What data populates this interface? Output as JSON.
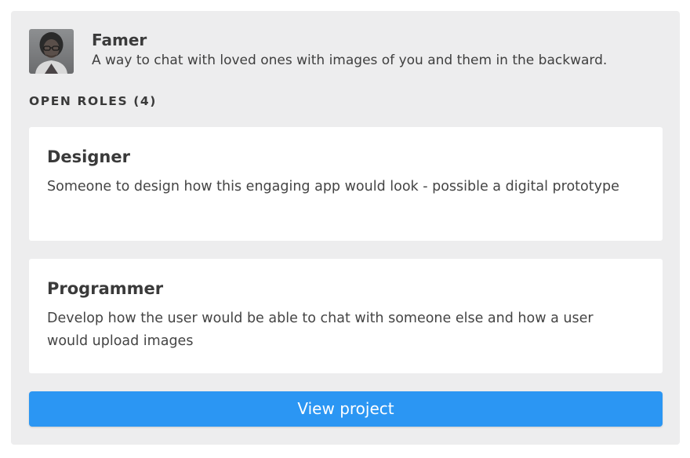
{
  "project": {
    "name": "Famer",
    "description": "A way to chat with loved ones with images of you and them in the backward.",
    "avatar_icon": "person-portrait-icon"
  },
  "roles": {
    "heading": "OPEN ROLES (4)",
    "items": [
      {
        "title": "Designer",
        "description": "Someone to design how this engaging app would look - possible a digital prototype"
      },
      {
        "title": "Programmer",
        "description": "Develop how the user would be able to chat with someone else and how a user would upload images"
      }
    ]
  },
  "actions": {
    "view_project_label": "View project"
  },
  "colors": {
    "card_background": "#ededee",
    "role_card_background": "#ffffff",
    "button_background": "#2b96f3",
    "button_text": "#ffffff"
  }
}
